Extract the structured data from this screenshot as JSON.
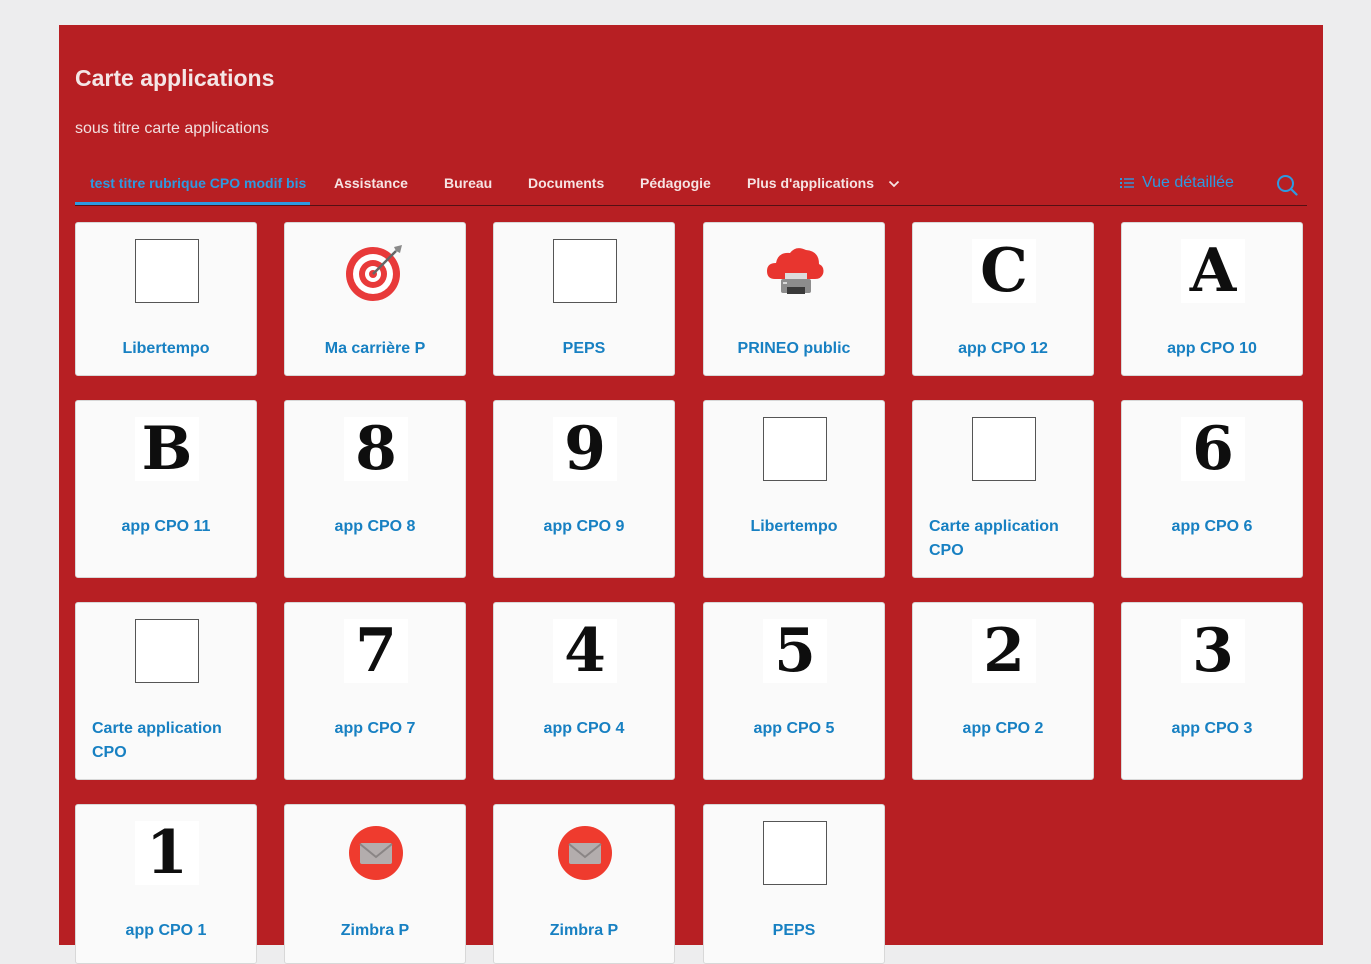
{
  "card": {
    "title": "Carte applications",
    "subtitle": "sous titre carte applications"
  },
  "tabs": [
    {
      "label": "test titre rubrique CPO modif bis",
      "active": true
    },
    {
      "label": "Assistance"
    },
    {
      "label": "Bureau"
    },
    {
      "label": "Documents"
    },
    {
      "label": "Pédagogie"
    },
    {
      "label": "Plus d'applications"
    }
  ],
  "toolbar": {
    "view_label": "Vue détaillée"
  },
  "icons": {
    "view": "list-icon",
    "search": "search-icon",
    "more": "chevron-down-icon"
  },
  "colors": {
    "accent": "#2e9ae0",
    "panel": "#b71f23",
    "tile_label": "#1780c2"
  },
  "apps": [
    {
      "label": "Libertempo",
      "icon": "blank"
    },
    {
      "label": "Ma carrière P",
      "icon": "target"
    },
    {
      "label": "PEPS",
      "icon": "blank"
    },
    {
      "label": "PRINEO public",
      "icon": "cloud-printer"
    },
    {
      "label": "app CPO 12",
      "icon": "glyph",
      "glyph": "C"
    },
    {
      "label": "app CPO 10",
      "icon": "glyph",
      "glyph": "A"
    },
    {
      "label": "app CPO 11",
      "icon": "glyph",
      "glyph": "B"
    },
    {
      "label": "app CPO 8",
      "icon": "glyph",
      "glyph": "8"
    },
    {
      "label": "app CPO 9",
      "icon": "glyph",
      "glyph": "9"
    },
    {
      "label": "Libertempo",
      "icon": "blank"
    },
    {
      "label": "Carte application CPO",
      "icon": "blank"
    },
    {
      "label": "app CPO 6",
      "icon": "glyph",
      "glyph": "6"
    },
    {
      "label": "Carte application CPO",
      "icon": "blank"
    },
    {
      "label": "app CPO 7",
      "icon": "glyph",
      "glyph": "7"
    },
    {
      "label": "app CPO 4",
      "icon": "glyph",
      "glyph": "4"
    },
    {
      "label": "app CPO 5",
      "icon": "glyph",
      "glyph": "5"
    },
    {
      "label": "app CPO 2",
      "icon": "glyph",
      "glyph": "2"
    },
    {
      "label": "app CPO 3",
      "icon": "glyph",
      "glyph": "3"
    },
    {
      "label": "app CPO 1",
      "icon": "glyph",
      "glyph": "1"
    },
    {
      "label": "Zimbra P",
      "icon": "mail"
    },
    {
      "label": "Zimbra P",
      "icon": "mail"
    },
    {
      "label": "PEPS",
      "icon": "blank"
    }
  ]
}
